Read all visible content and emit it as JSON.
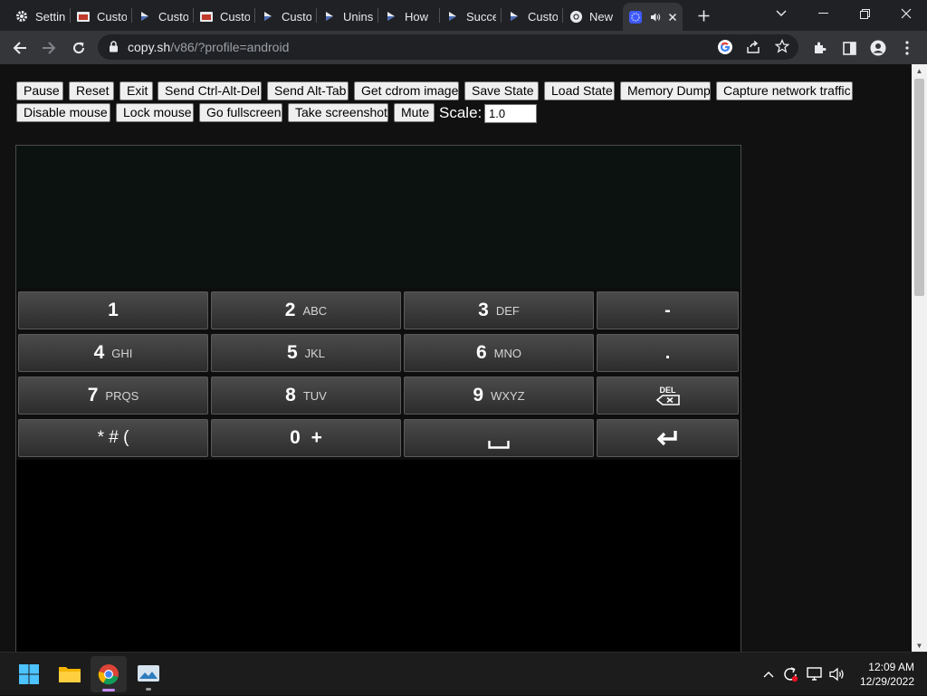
{
  "browser": {
    "tabs": [
      {
        "label": "Settin",
        "icon": "gear-icon"
      },
      {
        "label": "Custo",
        "icon": "folder-page-icon"
      },
      {
        "label": "Custo",
        "icon": "play-icon"
      },
      {
        "label": "Custo",
        "icon": "folder-page-icon"
      },
      {
        "label": "Custo",
        "icon": "play-icon"
      },
      {
        "label": "Unins",
        "icon": "play-icon"
      },
      {
        "label": "How",
        "icon": "play-icon"
      },
      {
        "label": "Succe",
        "icon": "play-icon"
      },
      {
        "label": "Custo",
        "icon": "play-icon"
      },
      {
        "label": "New",
        "icon": "chrome-icon"
      }
    ],
    "active_tab_icon": "v86-icon",
    "url_host": "copy.sh",
    "url_path": "/v86/?profile=android"
  },
  "controls": {
    "row1": [
      "Pause",
      "Reset",
      "Exit",
      "Send Ctrl-Alt-Del",
      "Send Alt-Tab",
      "Get cdrom image",
      "Save State",
      "Load State",
      "Memory Dump",
      "Capture network traffic"
    ],
    "row2": [
      "Disable mouse",
      "Lock mouse",
      "Go fullscreen",
      "Take screenshot",
      "Mute"
    ],
    "scale_label": "Scale:",
    "scale_value": "1.0"
  },
  "keypad": {
    "keys": [
      {
        "main": "1",
        "sub": ""
      },
      {
        "main": "2",
        "sub": "ABC"
      },
      {
        "main": "3",
        "sub": "DEF"
      },
      {
        "main": "-",
        "sub": ""
      },
      {
        "main": "4",
        "sub": "GHI"
      },
      {
        "main": "5",
        "sub": "JKL"
      },
      {
        "main": "6",
        "sub": "MNO"
      },
      {
        "main": ".",
        "sub": ""
      },
      {
        "main": "7",
        "sub": "PRQS"
      },
      {
        "main": "8",
        "sub": "TUV"
      },
      {
        "main": "9",
        "sub": "WXYZ"
      },
      {
        "main": "DEL",
        "sub": ""
      },
      {
        "main": "* # (",
        "sub": ""
      },
      {
        "main": "0 +",
        "sub": ""
      },
      {
        "main": "",
        "sub": ""
      },
      {
        "main": "",
        "sub": ""
      }
    ]
  },
  "taskbar": {
    "time": "12:09 AM",
    "date": "12/29/2022"
  }
}
